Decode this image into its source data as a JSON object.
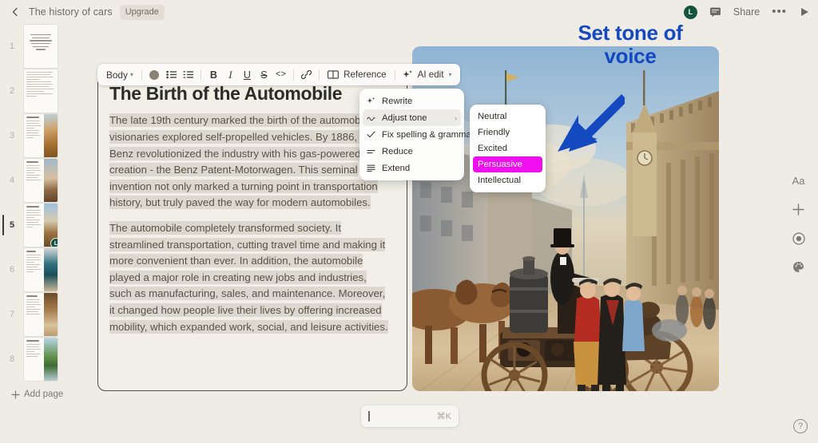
{
  "topbar": {
    "back_icon": "chevron-left-icon",
    "title": "The history of cars",
    "upgrade_label": "Upgrade",
    "avatar_initial": "L",
    "comment_icon": "comment-icon",
    "share_label": "Share",
    "more_label": "•••",
    "present_icon": "play-icon"
  },
  "sidebar": {
    "pages": [
      {
        "num": "1",
        "layout": "title",
        "selected": false
      },
      {
        "num": "2",
        "layout": "list",
        "selected": false
      },
      {
        "num": "3",
        "layout": "text-image",
        "selected": false,
        "img": "desert"
      },
      {
        "num": "4",
        "layout": "text-image",
        "selected": false,
        "img": "sky"
      },
      {
        "num": "5",
        "layout": "text-image",
        "selected": true,
        "img": "street",
        "badge": "L"
      },
      {
        "num": "6",
        "layout": "text-image",
        "selected": false,
        "img": "car"
      },
      {
        "num": "7",
        "layout": "text-image",
        "selected": false,
        "img": "factory"
      },
      {
        "num": "8",
        "layout": "text-image",
        "selected": false,
        "img": "green"
      }
    ],
    "add_page_label": "Add page",
    "add_page_icon": "plus-icon"
  },
  "toolbar": {
    "style_label": "Body",
    "style_chevron": "chevron-down-icon",
    "color_swatch": "#8b8276",
    "bullet_list_icon": "bullet-list-icon",
    "numbered_list_icon": "numbered-list-icon",
    "bold_label": "B",
    "italic_label": "I",
    "underline_label": "U",
    "strike_label": "S",
    "code_label": "<>",
    "link_icon": "link-icon",
    "reference_icon": "book-icon",
    "reference_label": "Reference",
    "ai_icon": "sparkle-icon",
    "ai_label": "AI edit",
    "ai_chevron": "chevron-down-icon"
  },
  "ai_menu": {
    "items": [
      {
        "label": "Rewrite",
        "icon": "sparkle-icon",
        "active": false,
        "submenu": false
      },
      {
        "label": "Adjust tone",
        "icon": "wave-icon",
        "active": true,
        "submenu": true
      },
      {
        "label": "Fix spelling & grammar",
        "icon": "check-icon",
        "active": false,
        "submenu": false
      },
      {
        "label": "Reduce",
        "icon": "reduce-lines-icon",
        "active": false,
        "submenu": false
      },
      {
        "label": "Extend",
        "icon": "extend-lines-icon",
        "active": false,
        "submenu": false
      }
    ]
  },
  "tone_menu": {
    "items": [
      {
        "label": "Neutral",
        "highlighted": false
      },
      {
        "label": "Friendly",
        "highlighted": false
      },
      {
        "label": "Excited",
        "highlighted": false
      },
      {
        "label": "Persuasive",
        "highlighted": true
      },
      {
        "label": "Intellectual",
        "highlighted": false
      }
    ],
    "highlight_color": "#ef0fef"
  },
  "document": {
    "heading": "The Birth of the Automobile",
    "paragraph1": "The late 19th century marked the birth of the automobile, as visionaries explored self-propelled vehicles. By 1886, Karl Benz revolutionized the industry with his gas-powered creation - the Benz Patent-Motorwagen. This seminal invention not only marked a turning point in transportation history, but truly paved the way for modern automobiles.",
    "paragraph2": "The automobile completely transformed society. It streamlined transportation, cutting travel time and making it more convenient than ever. In addition, the automobile played a major role in creating new jobs and industries, such as manufacturing, sales, and maintenance. Moreover, it changed how people live their lives by offering increased mobility, which expanded work, social, and leisure activities.",
    "image_alt": "Historical street scene with a steam-powered carriage, horses and people in 19th century dress"
  },
  "annotation": {
    "text": "Set tone of voice",
    "color": "#1449c0",
    "arrow_icon": "arrow-down-left-icon"
  },
  "rail": {
    "text_label": "Aa",
    "add_icon": "plus-icon",
    "record_icon": "record-circle-icon",
    "palette_icon": "palette-icon"
  },
  "command_bar": {
    "value": "",
    "placeholder": "",
    "shortcut": "⌘K"
  },
  "help": {
    "label": "?"
  }
}
